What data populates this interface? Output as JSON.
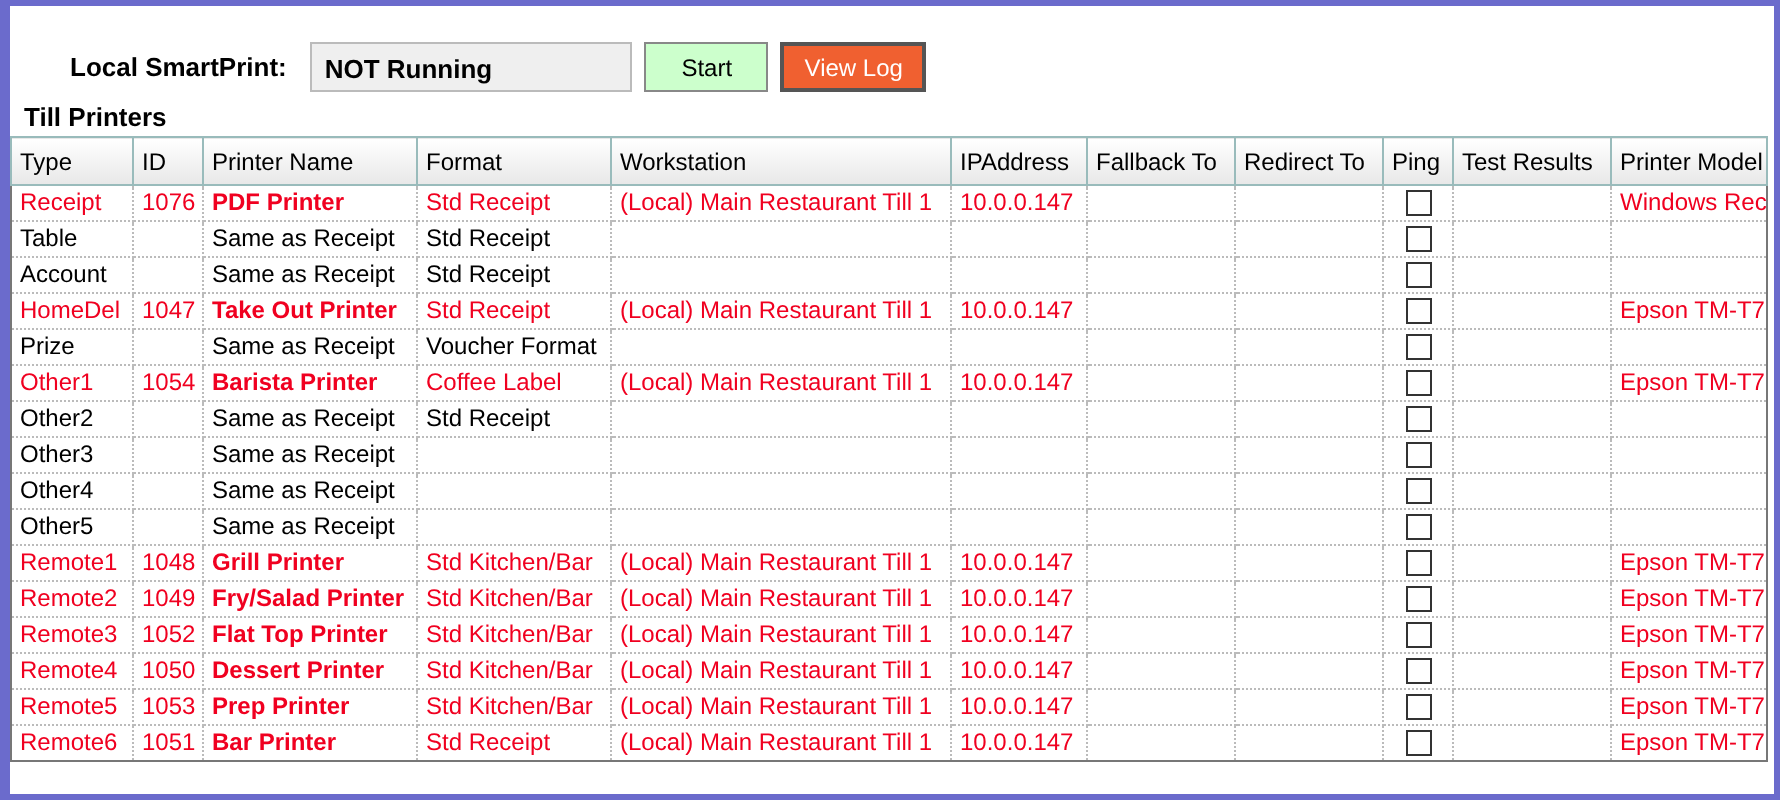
{
  "status": {
    "label": "Local SmartPrint:",
    "value": "NOT Running"
  },
  "buttons": [
    {
      "kind": "start",
      "label": "Start"
    },
    {
      "kind": "log",
      "label": "View Log"
    }
  ],
  "section_title": "Till Printers",
  "table": {
    "columns": [
      "Type",
      "ID",
      "Printer Name",
      "Format",
      "Workstation",
      "IPAddress",
      "Fallback To",
      "Redirect To",
      "Ping",
      "Test Results",
      "Printer Model"
    ],
    "rows": [
      {
        "active": true,
        "type": "Receipt",
        "id": "1076",
        "printer_name": "PDF Printer",
        "format": "Std Receipt",
        "workstation": "(Local) Main Restaurant Till 1",
        "ip_address": "10.0.0.147",
        "ping": false,
        "printer_model": "Windows Rec"
      },
      {
        "active": false,
        "type": "Table",
        "printer_name": "Same as Receipt",
        "format": "Std Receipt",
        "ping": false
      },
      {
        "active": false,
        "type": "Account",
        "printer_name": "Same as Receipt",
        "format": "Std Receipt",
        "ping": false
      },
      {
        "active": true,
        "type": "HomeDel",
        "id": "1047",
        "printer_name": "Take Out Printer",
        "format": "Std Receipt",
        "workstation": "(Local) Main Restaurant Till 1",
        "ip_address": "10.0.0.147",
        "ping": false,
        "printer_model": "Epson TM-T7"
      },
      {
        "active": false,
        "type": "Prize",
        "printer_name": "Same as Receipt",
        "format": "Voucher Format",
        "ping": false
      },
      {
        "active": true,
        "type": "Other1",
        "id": "1054",
        "printer_name": "Barista Printer",
        "format": "Coffee Label",
        "workstation": "(Local) Main Restaurant Till 1",
        "ip_address": "10.0.0.147",
        "ping": false,
        "printer_model": "Epson TM-T7"
      },
      {
        "active": false,
        "type": "Other2",
        "printer_name": "Same as Receipt",
        "format": "Std Receipt",
        "ping": false
      },
      {
        "active": false,
        "type": "Other3",
        "printer_name": "Same as Receipt",
        "ping": false
      },
      {
        "active": false,
        "type": "Other4",
        "printer_name": "Same as Receipt",
        "ping": false
      },
      {
        "active": false,
        "type": "Other5",
        "printer_name": "Same as Receipt",
        "ping": false
      },
      {
        "active": true,
        "type": "Remote1",
        "id": "1048",
        "printer_name": "Grill Printer",
        "format": "Std Kitchen/Bar",
        "workstation": "(Local) Main Restaurant Till 1",
        "ip_address": "10.0.0.147",
        "ping": false,
        "printer_model": "Epson TM-T7"
      },
      {
        "active": true,
        "type": "Remote2",
        "id": "1049",
        "printer_name": "Fry/Salad Printer",
        "format": "Std Kitchen/Bar",
        "workstation": "(Local) Main Restaurant Till 1",
        "ip_address": "10.0.0.147",
        "ping": false,
        "printer_model": "Epson TM-T7"
      },
      {
        "active": true,
        "type": "Remote3",
        "id": "1052",
        "printer_name": "Flat Top Printer",
        "format": "Std Kitchen/Bar",
        "workstation": "(Local) Main Restaurant Till 1",
        "ip_address": "10.0.0.147",
        "ping": false,
        "printer_model": "Epson TM-T7"
      },
      {
        "active": true,
        "type": "Remote4",
        "id": "1050",
        "printer_name": "Dessert Printer",
        "format": "Std Kitchen/Bar",
        "workstation": "(Local) Main Restaurant Till 1",
        "ip_address": "10.0.0.147",
        "ping": false,
        "printer_model": "Epson TM-T7"
      },
      {
        "active": true,
        "type": "Remote5",
        "id": "1053",
        "printer_name": "Prep Printer",
        "format": "Std Kitchen/Bar",
        "workstation": "(Local) Main Restaurant Till 1",
        "ip_address": "10.0.0.147",
        "ping": false,
        "printer_model": "Epson TM-T7"
      },
      {
        "active": true,
        "type": "Remote6",
        "id": "1051",
        "printer_name": "Bar Printer",
        "format": "Std Receipt",
        "workstation": "(Local) Main Restaurant Till 1",
        "ip_address": "10.0.0.147",
        "ping": false,
        "printer_model": "Epson TM-T7"
      }
    ]
  }
}
